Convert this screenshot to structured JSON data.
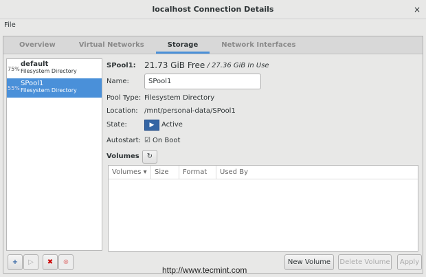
{
  "window": {
    "title": "localhost Connection Details",
    "close": "×"
  },
  "menu": {
    "file": "File"
  },
  "tabs": [
    "Overview",
    "Virtual Networks",
    "Storage",
    "Network Interfaces"
  ],
  "pools": [
    {
      "pct": "75%",
      "name": "default",
      "type": "Filesystem Directory"
    },
    {
      "pct": "55%",
      "name": "SPool1",
      "type": "Filesystem Directory"
    }
  ],
  "detail": {
    "title": "SPool1:",
    "free": "21.73 GiB Free",
    "inuse": "/ 27.36 GiB In Use",
    "name_label": "Name:",
    "name_value": "SPool1",
    "type_label": "Pool Type:",
    "type_value": "Filesystem Directory",
    "loc_label": "Location:",
    "loc_value": "/mnt/personal-data/SPool1",
    "state_label": "State:",
    "state_value": "Active",
    "auto_label": "Autostart:",
    "auto_value": "On Boot",
    "volumes_label": "Volumes"
  },
  "volume_columns": [
    "Volumes ▾",
    "Size",
    "Format",
    "Used By"
  ],
  "buttons": {
    "new_volume": "New Volume",
    "delete_volume": "Delete Volume",
    "apply": "Apply"
  },
  "watermark": "http://www.tecmint.com"
}
